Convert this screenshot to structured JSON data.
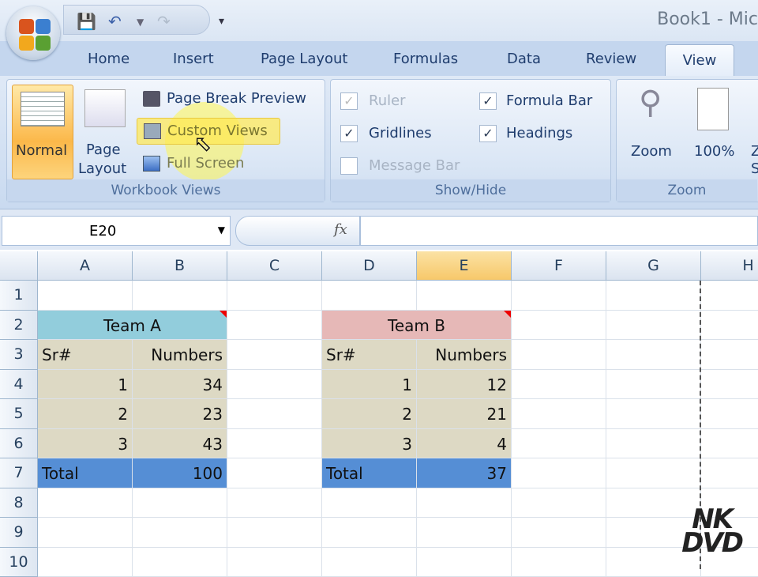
{
  "window": {
    "title": "Book1 - Mic"
  },
  "tabs": [
    "Home",
    "Insert",
    "Page Layout",
    "Formulas",
    "Data",
    "Review",
    "View"
  ],
  "active_tab": "View",
  "ribbon": {
    "workbook_views": {
      "label": "Workbook Views",
      "normal": "Normal",
      "page_layout_1": "Page",
      "page_layout_2": "Layout",
      "page_break_preview": "Page Break Preview",
      "custom_views": "Custom Views",
      "full_screen": "Full Screen"
    },
    "show_hide": {
      "label": "Show/Hide",
      "ruler": "Ruler",
      "gridlines": "Gridlines",
      "message_bar": "Message Bar",
      "formula_bar": "Formula Bar",
      "headings": "Headings",
      "ruler_checked": true,
      "gridlines_checked": true,
      "message_bar_checked": false,
      "formula_bar_checked": true,
      "headings_checked": true
    },
    "zoom": {
      "label": "Zoom",
      "zoom": "Zoom",
      "hundred": "100%",
      "zoom_sel_1": "Z",
      "zoom_sel_2": "S"
    }
  },
  "formula_bar": {
    "name_box": "E20",
    "fx": "fx",
    "formula": ""
  },
  "columns": [
    "A",
    "B",
    "C",
    "D",
    "E",
    "F",
    "G",
    "H"
  ],
  "selected_column": "E",
  "rows": [
    "1",
    "2",
    "3",
    "4",
    "5",
    "6",
    "7",
    "8",
    "9",
    "10"
  ],
  "team_a": {
    "title": "Team A",
    "h1": "Sr#",
    "h2": "Numbers",
    "data": [
      [
        "1",
        "34"
      ],
      [
        "2",
        "23"
      ],
      [
        "3",
        "43"
      ]
    ],
    "total_label": "Total",
    "total": "100"
  },
  "team_b": {
    "title": "Team B",
    "h1": "Sr#",
    "h2": "Numbers",
    "data": [
      [
        "1",
        "12"
      ],
      [
        "2",
        "21"
      ],
      [
        "3",
        "4"
      ]
    ],
    "total_label": "Total",
    "total": "37"
  },
  "watermark": {
    "line1": "NK",
    "line2": "DVD"
  },
  "colors": {
    "team_a_header": "#92cddc",
    "team_b_header": "#e6b8b7",
    "body": "#ddd9c4",
    "total": "#558ed5"
  }
}
